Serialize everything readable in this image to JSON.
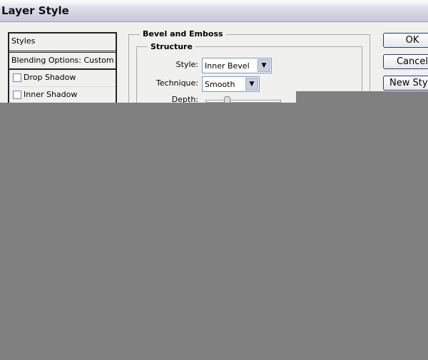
{
  "window": {
    "title": "Layer Style"
  },
  "sidebar": {
    "items": [
      {
        "label": "Styles"
      },
      {
        "label": "Blending Options: Custom"
      },
      {
        "label": "Drop Shadow",
        "checked": false
      },
      {
        "label": "Inner Shadow",
        "checked": false
      }
    ]
  },
  "panel": {
    "title": "Bevel and Emboss",
    "structure": {
      "title": "Structure",
      "style_label": "Style:",
      "style_value": "Inner Bevel",
      "technique_label": "Technique:",
      "technique_value": "Smooth",
      "depth_label": "Depth:"
    }
  },
  "buttons": {
    "ok": "OK",
    "cancel": "Cancel",
    "new_style": "New Style..."
  }
}
